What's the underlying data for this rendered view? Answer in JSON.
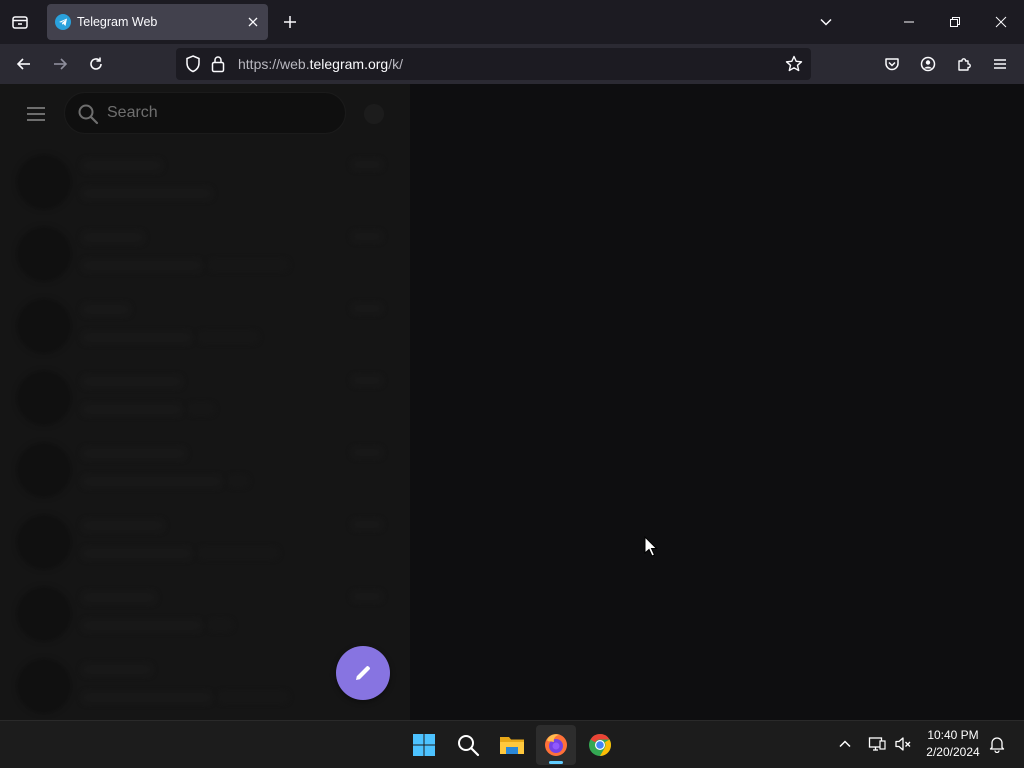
{
  "browser": {
    "tab": {
      "title": "Telegram Web",
      "favicon": "telegram-icon"
    },
    "url": {
      "scheme": "https://web.",
      "host": "telegram.org",
      "path": "/k/"
    },
    "icons": [
      "tab-list-icon",
      "close-icon",
      "plus-icon",
      "chevron-down-icon",
      "minimize-icon",
      "restore-icon",
      "window-close-icon",
      "back-icon",
      "forward-icon",
      "reload-icon",
      "shield-icon",
      "lock-icon",
      "star-icon",
      "pocket-icon",
      "account-icon",
      "extensions-icon",
      "menu-icon"
    ]
  },
  "sidebar": {
    "search": {
      "placeholder": "Search"
    },
    "chats": [
      {
        "name_width": 80,
        "preview_width": 130,
        "preview2_width": 0
      },
      {
        "name_width": 62,
        "preview_width": 120,
        "preview2_width": 80
      },
      {
        "name_width": 48,
        "preview_width": 110,
        "preview2_width": 60
      },
      {
        "name_width": 100,
        "preview_width": 100,
        "preview2_width": 26
      },
      {
        "name_width": 104,
        "preview_width": 140,
        "preview2_width": 20
      },
      {
        "name_width": 82,
        "preview_width": 110,
        "preview2_width": 80
      },
      {
        "name_width": 74,
        "preview_width": 120,
        "preview2_width": 24
      },
      {
        "name_width": 70,
        "preview_width": 130,
        "preview2_width": 70
      }
    ],
    "compose_icon": "pencil-icon"
  },
  "colors": {
    "accent": "#8774e1",
    "sidebar_bg": "#212121",
    "main_bg": "#0e0e10",
    "tab_active": "#42414d"
  },
  "taskbar": {
    "apps": [
      "windows-start-icon",
      "search-icon",
      "file-explorer-icon",
      "firefox-icon",
      "chrome-icon"
    ],
    "clock": {
      "time": "10:40 PM",
      "date": "2/20/2024"
    }
  }
}
